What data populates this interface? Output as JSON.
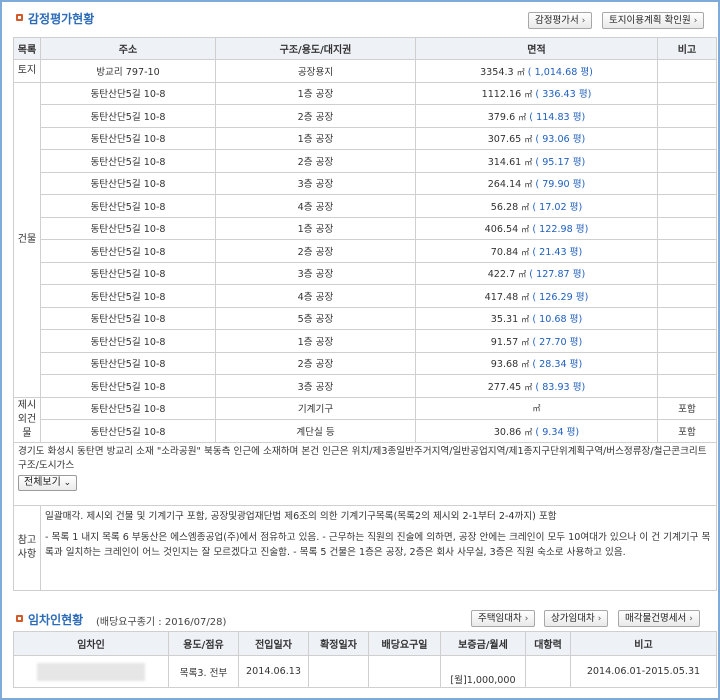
{
  "appraisal": {
    "title": "감정평가현황",
    "buttons": {
      "appraisal_doc": "감정평가서",
      "land_use": "토지이용계획 확인원"
    },
    "headers": {
      "category": "목록",
      "address": "주소",
      "structure": "구조/용도/대지권",
      "area": "면적",
      "note": "비고"
    },
    "land": {
      "category": "토지",
      "address": "방교리 797-10",
      "structure": "공장용지",
      "area": "3354.3",
      "pyeong": "( 1,014.68 평)",
      "note": ""
    },
    "building_category": "건물",
    "buildings": [
      {
        "address": "동탄산단5길 10-8",
        "structure": "1층 공장",
        "area": "1112.16",
        "pyeong": "( 336.43 평)"
      },
      {
        "address": "동탄산단5길 10-8",
        "structure": "2층 공장",
        "area": "379.6",
        "pyeong": "( 114.83 평)"
      },
      {
        "address": "동탄산단5길 10-8",
        "structure": "1층 공장",
        "area": "307.65",
        "pyeong": "( 93.06 평)"
      },
      {
        "address": "동탄산단5길 10-8",
        "structure": "2층 공장",
        "area": "314.61",
        "pyeong": "( 95.17 평)"
      },
      {
        "address": "동탄산단5길 10-8",
        "structure": "3층 공장",
        "area": "264.14",
        "pyeong": "( 79.90 평)"
      },
      {
        "address": "동탄산단5길 10-8",
        "structure": "4층 공장",
        "area": "56.28",
        "pyeong": "( 17.02 평)"
      },
      {
        "address": "동탄산단5길 10-8",
        "structure": "1층 공장",
        "area": "406.54",
        "pyeong": "( 122.98 평)"
      },
      {
        "address": "동탄산단5길 10-8",
        "structure": "2층 공장",
        "area": "70.84",
        "pyeong": "( 21.43 평)"
      },
      {
        "address": "동탄산단5길 10-8",
        "structure": "3층 공장",
        "area": "422.7",
        "pyeong": "( 127.87 평)"
      },
      {
        "address": "동탄산단5길 10-8",
        "structure": "4층 공장",
        "area": "417.48",
        "pyeong": "( 126.29 평)"
      },
      {
        "address": "동탄산단5길 10-8",
        "structure": "5층 공장",
        "area": "35.31",
        "pyeong": "( 10.68 평)"
      },
      {
        "address": "동탄산단5길 10-8",
        "structure": "1층 공장",
        "area": "91.57",
        "pyeong": "( 27.70 평)"
      },
      {
        "address": "동탄산단5길 10-8",
        "structure": "2층 공장",
        "area": "93.68",
        "pyeong": "( 28.34 평)"
      },
      {
        "address": "동탄산단5길 10-8",
        "structure": "3층 공장",
        "area": "277.45",
        "pyeong": "( 83.93 평)"
      }
    ],
    "excluded_category": "제시외건물",
    "excluded": [
      {
        "address": "동탄산단5길 10-8",
        "structure": "기계기구",
        "area": "",
        "pyeong": "",
        "note": "포함"
      },
      {
        "address": "동탄산단5길 10-8",
        "structure": "계단실 등",
        "area": "30.86",
        "pyeong": "( 9.34 평)",
        "note": "포함"
      }
    ],
    "unit": "㎡",
    "location_memo": "경기도 화성시 동탄면 방교리 소재 \"소라공원\" 북동측 인근에 소재하며 본건 인근은 위치/제3종일반주거지역/일반공업지역/제1종지구단위계획구역/버스정류장/철근콘크리트구조/도시가스",
    "view_all": "전체보기",
    "other_category": "참고사항",
    "other_text_1": "일괄매각. 제시외 건물 및 기계기구 포함, 공장및광업재단법 제6조의 의한 기계기구목록(목록2의 제시외 2-1부터 2-4까지) 포함",
    "other_text_2": "- 목록 1 내지 목록 6 부동산은 에스엠종공업(주)에서 점유하고 있음. - 근무하는 직원의 진술에 의하면, 공장 안에는 크레인이 모두 10여대가 있으나 이 건 기계기구 목록과 일치하는 크레인이 어느 것인지는 잘 모르겠다고 진술함. - 목록 5 건물은 1층은 공장, 2층은 회사 사무실, 3층은 직원 숙소로 사용하고 있음."
  },
  "tenants": {
    "title": "임차인현황",
    "subtitle": "(배당요구종기 : 2016/07/28)",
    "buttons": {
      "house_lease": "주택임대차",
      "commercial_lease": "상가임대차",
      "sale_building": "매각물건명세서"
    },
    "headers": {
      "tenant": "임차인",
      "use": "용도/점유",
      "move_in": "전입일자",
      "fixed_date": "확정일자",
      "dividend_date": "배당요구일",
      "deposit": "보증금/월세",
      "opposing": "대항력",
      "note": "비고"
    },
    "rows": [
      {
        "use": "목록3. 전부",
        "move_in": "2014.06.13",
        "fixed_date": "",
        "dividend_date": "",
        "deposit": "[월]1,000,000",
        "opposing": "",
        "note": "2014.06.01-2015.05.31"
      }
    ]
  }
}
